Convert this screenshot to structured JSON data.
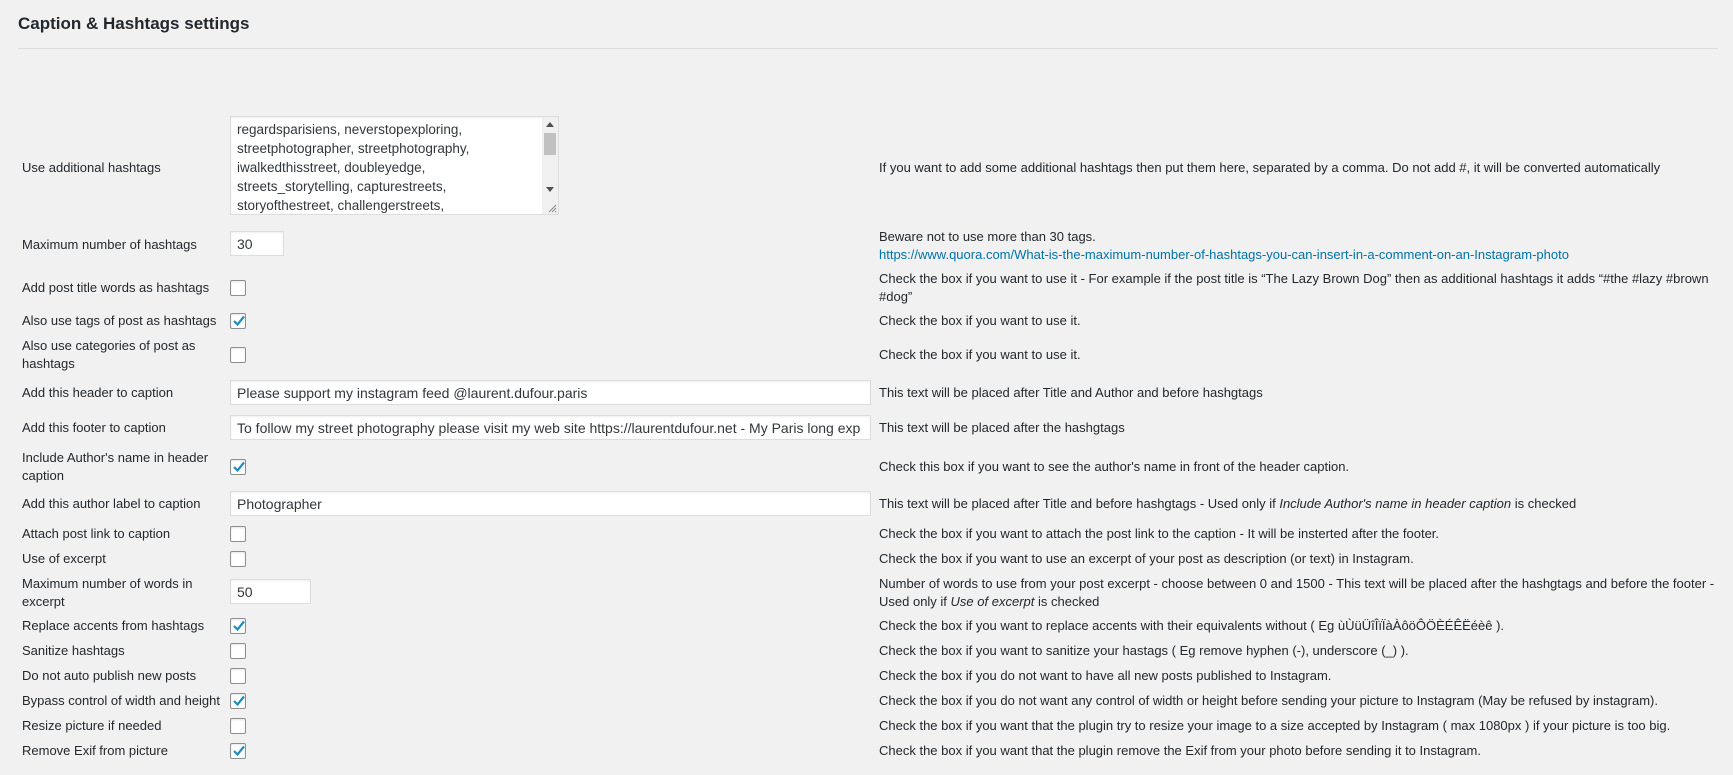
{
  "page": {
    "title": "Caption & Hashtags settings"
  },
  "colors": {
    "link": "#0073aa",
    "check": "#1e8cbe"
  },
  "rows": {
    "additional_hashtags": {
      "label": "Use additional hashtags",
      "value_lines": "regardsparisiens, neverstopexploring,\nstreetphotographer, streetphotography,\niwalkedthisstreet, doubleyedge,\nstreets_storytelling,  capturestreets,\nstoryofthestreet, challengerstreets,",
      "description": "If you want to add some additional hashtags then put them here, separated by a comma. Do not add #, it will be converted automatically"
    },
    "max_hashtags": {
      "label": "Maximum number of hashtags",
      "value": "30",
      "description": "Beware not to use more than 30 tags.",
      "link": "https://www.quora.com/What-is-the-maximum-number-of-hashtags-you-can-insert-in-a-comment-on-an-Instagram-photo"
    },
    "post_title_words": {
      "label": "Add post title words as hashtags",
      "checked": false,
      "description": "Check the box if you want to use it - For example if the post title is “The Lazy Brown Dog” then as additional hashtags it adds “#the #lazy #brown #dog”"
    },
    "tags_as_hashtags": {
      "label": "Also use tags of post as hashtags",
      "checked": true,
      "description": "Check the box if you want to use it."
    },
    "categories_as_hashtags": {
      "label": "Also use categories of post as hashtags",
      "checked": false,
      "description": "Check the box if you want to use it."
    },
    "header_caption": {
      "label": "Add this header to caption",
      "value": "Please support my instagram feed @laurent.dufour.paris",
      "description": "This text will be placed after Title and Author and before hashgtags"
    },
    "footer_caption": {
      "label": "Add this footer to caption",
      "value": "To follow my street photography please visit my web site https://laurentdufour.net - My Paris long exp",
      "description": "This text will be placed after the hashgtags"
    },
    "author_name": {
      "label": "Include Author's name in header caption",
      "checked": true,
      "description": "Check this box if you want to see the author's name in front of the header caption."
    },
    "author_label": {
      "label": "Add this author label to caption",
      "value": "Photographer",
      "description_pre": "This text will be placed after Title and before hashgtags - Used only if ",
      "description_em": "Include Author's name in header caption",
      "description_post": " is checked"
    },
    "post_link": {
      "label": "Attach post link to caption",
      "checked": false,
      "description": "Check the box if you want to attach the post link to the caption - It will be insterted after the footer."
    },
    "excerpt": {
      "label": "Use of excerpt",
      "checked": false,
      "description": "Check the box if you want to use an excerpt of your post as description (or text) in Instagram."
    },
    "max_words": {
      "label": "Maximum number of words in excerpt",
      "value": "50",
      "description_pre": "Number of words to use from your post excerpt - choose between 0 and 1500 - This text will be placed after the hashgtags and before the footer - Used only if ",
      "description_em": "Use of excerpt",
      "description_post": " is checked"
    },
    "replace_accents": {
      "label": "Replace accents from hashtags",
      "checked": true,
      "description": "Check the box if you want to replace accents with their equivalents without ( Eg ùÙüÜîÎïÏàÀôöÔÖÈÉÊËéèê )."
    },
    "sanitize": {
      "label": "Sanitize hashtags",
      "checked": false,
      "description": "Check the box if you want to sanitize your hastags ( Eg remove hyphen (-), underscore (_) )."
    },
    "no_auto_publish": {
      "label": "Do not auto publish new posts",
      "checked": false,
      "description": "Check the box if you do not want to have all new posts published to Instagram."
    },
    "bypass_control": {
      "label": "Bypass control of width and height",
      "checked": true,
      "description": "Check the box if you do not want any control of width or height before sending your picture to Instagram (May be refused by instagram)."
    },
    "resize": {
      "label": "Resize picture if needed",
      "checked": false,
      "description": "Check the box if you want that the plugin try to resize your image to a size accepted by Instagram ( max 1080px ) if your picture is too big."
    },
    "remove_exif": {
      "label": "Remove Exif from picture",
      "checked": true,
      "description": "Check the box if you want that the plugin remove the Exif from your photo before sending it to Instagram."
    }
  }
}
